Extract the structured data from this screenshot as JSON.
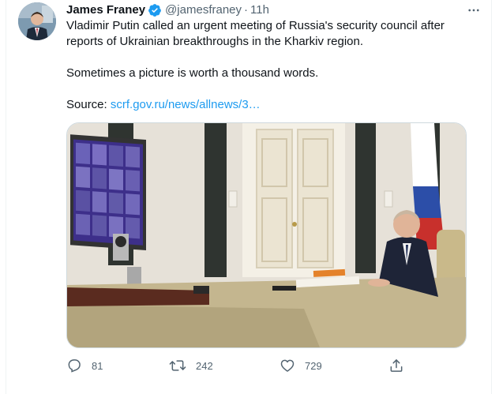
{
  "tweet": {
    "author_name": "James Franey",
    "handle": "@jamesfraney",
    "separator": "·",
    "time": "11h",
    "text_line1": "Vladimir Putin called an urgent meeting of Russia's security council after",
    "text_line2": "reports of Ukrainian breakthroughs in the Kharkiv region.",
    "text_line3": "Sometimes a picture is worth a thousand words.",
    "source_label": "Source:",
    "source_link": "scrf.gov.ru/news/allnews/3…"
  },
  "actions": {
    "replies": "81",
    "retweets": "242",
    "likes": "729"
  },
  "icons": {
    "verified": "verified-badge-icon",
    "more": "more-options-icon",
    "reply": "reply-icon",
    "retweet": "retweet-icon",
    "like": "heart-icon",
    "share": "share-icon"
  },
  "colors": {
    "accent": "#1d9bf0",
    "text": "#0f1419",
    "muted": "#536471"
  }
}
